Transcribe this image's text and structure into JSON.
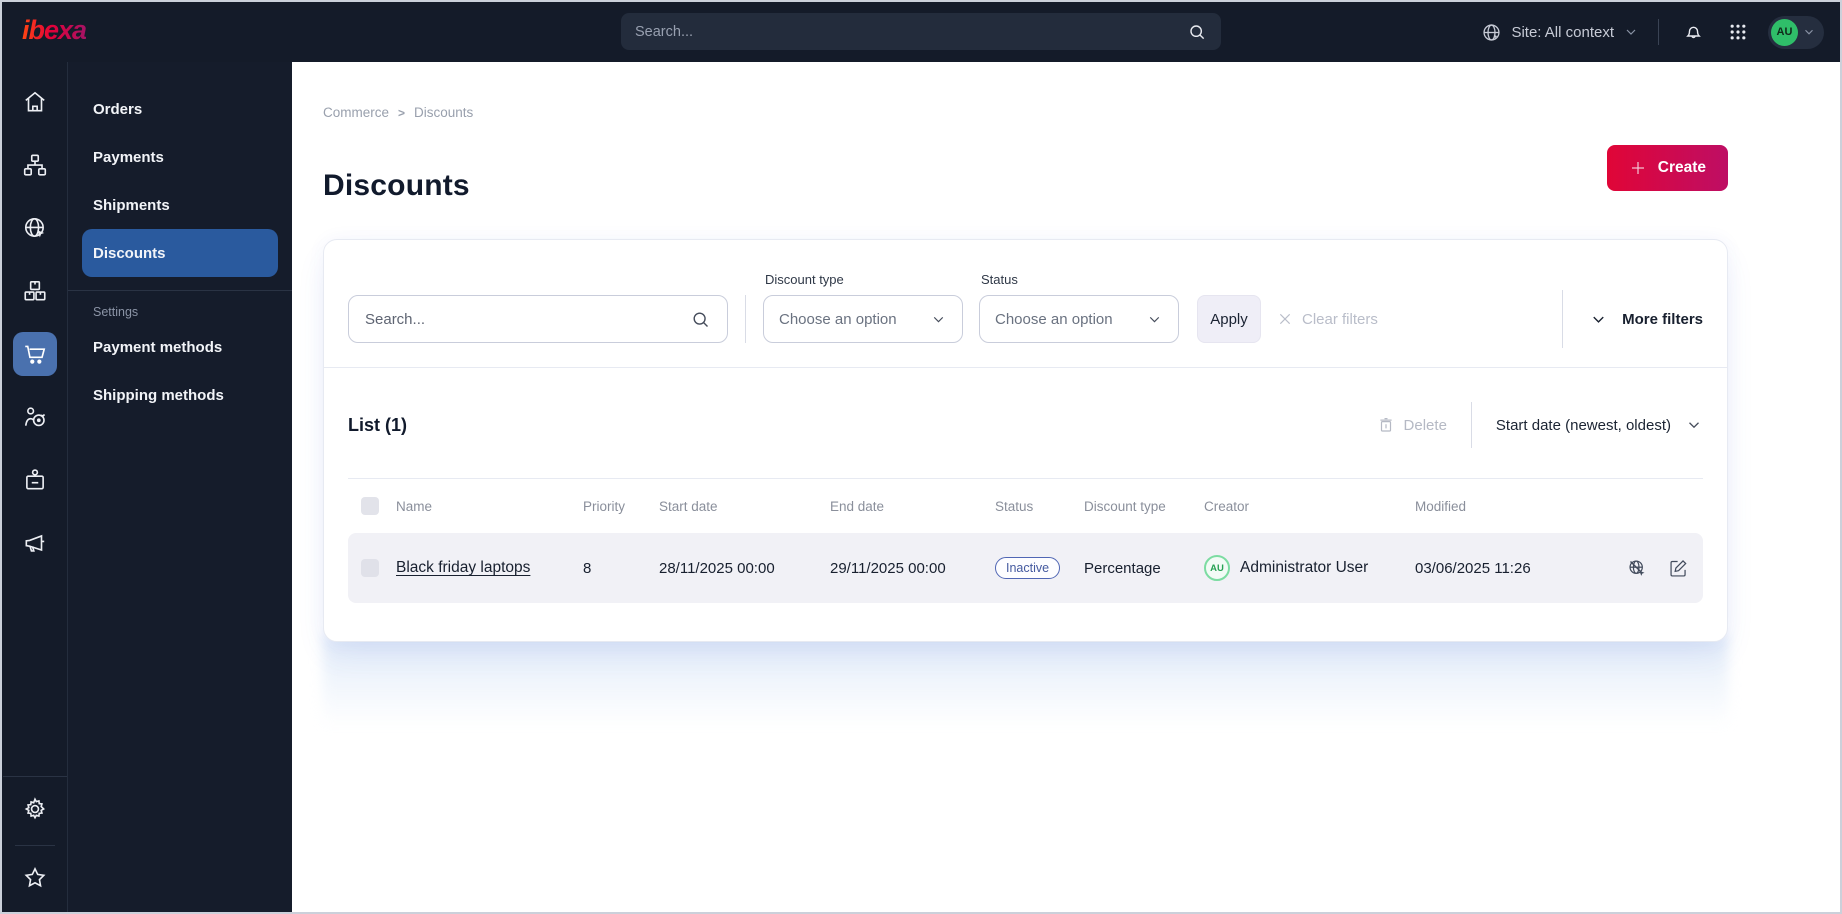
{
  "theme": {
    "brand_red": "#E00537",
    "brand_magenta": "#BE0E64",
    "active_blue": "#2A5A9E",
    "icon_tile_blue": "#4A71AE",
    "badge_blue": "#5066B4",
    "avatar_green": "#27A254",
    "dark_bg": "#141B29"
  },
  "topbar": {
    "logo": "ibexa",
    "search_placeholder": "Search...",
    "site_context": "Site: All context",
    "user_initials": "AU"
  },
  "icon_rail": {
    "items": [
      "home",
      "content-tree",
      "site",
      "products",
      "commerce",
      "personalization",
      "corporate",
      "marketing"
    ],
    "active": "commerce",
    "bottom": [
      "settings",
      "bookmarks"
    ]
  },
  "sidebar": {
    "items": [
      {
        "label": "Orders"
      },
      {
        "label": "Payments"
      },
      {
        "label": "Shipments"
      },
      {
        "label": "Discounts"
      }
    ],
    "section_label": "Settings",
    "settings_items": [
      {
        "label": "Payment methods"
      },
      {
        "label": "Shipping methods"
      }
    ]
  },
  "breadcrumb": {
    "items": [
      "Commerce",
      "Discounts"
    ],
    "separator": ">"
  },
  "page": {
    "title": "Discounts",
    "create_label": "Create"
  },
  "filters": {
    "search_placeholder": "Search...",
    "discount_type_label": "Discount type",
    "discount_type_value": "Choose an option",
    "status_label": "Status",
    "status_value": "Choose an option",
    "apply_label": "Apply",
    "clear_label": "Clear filters",
    "more_label": "More filters"
  },
  "list": {
    "title": "List (1)",
    "delete_label": "Delete",
    "sort_label": "Start date (newest, oldest)",
    "columns": [
      "Name",
      "Priority",
      "Start date",
      "End date",
      "Status",
      "Discount type",
      "Creator",
      "Modified"
    ],
    "rows": [
      {
        "name": "Black friday laptops",
        "priority": "8",
        "start_date": "28/11/2025 00:00",
        "end_date": "29/11/2025 00:00",
        "status": "Inactive",
        "discount_type": "Percentage",
        "creator_initials": "AU",
        "creator": "Administrator User",
        "modified": "03/06/2025 11:26"
      }
    ]
  }
}
